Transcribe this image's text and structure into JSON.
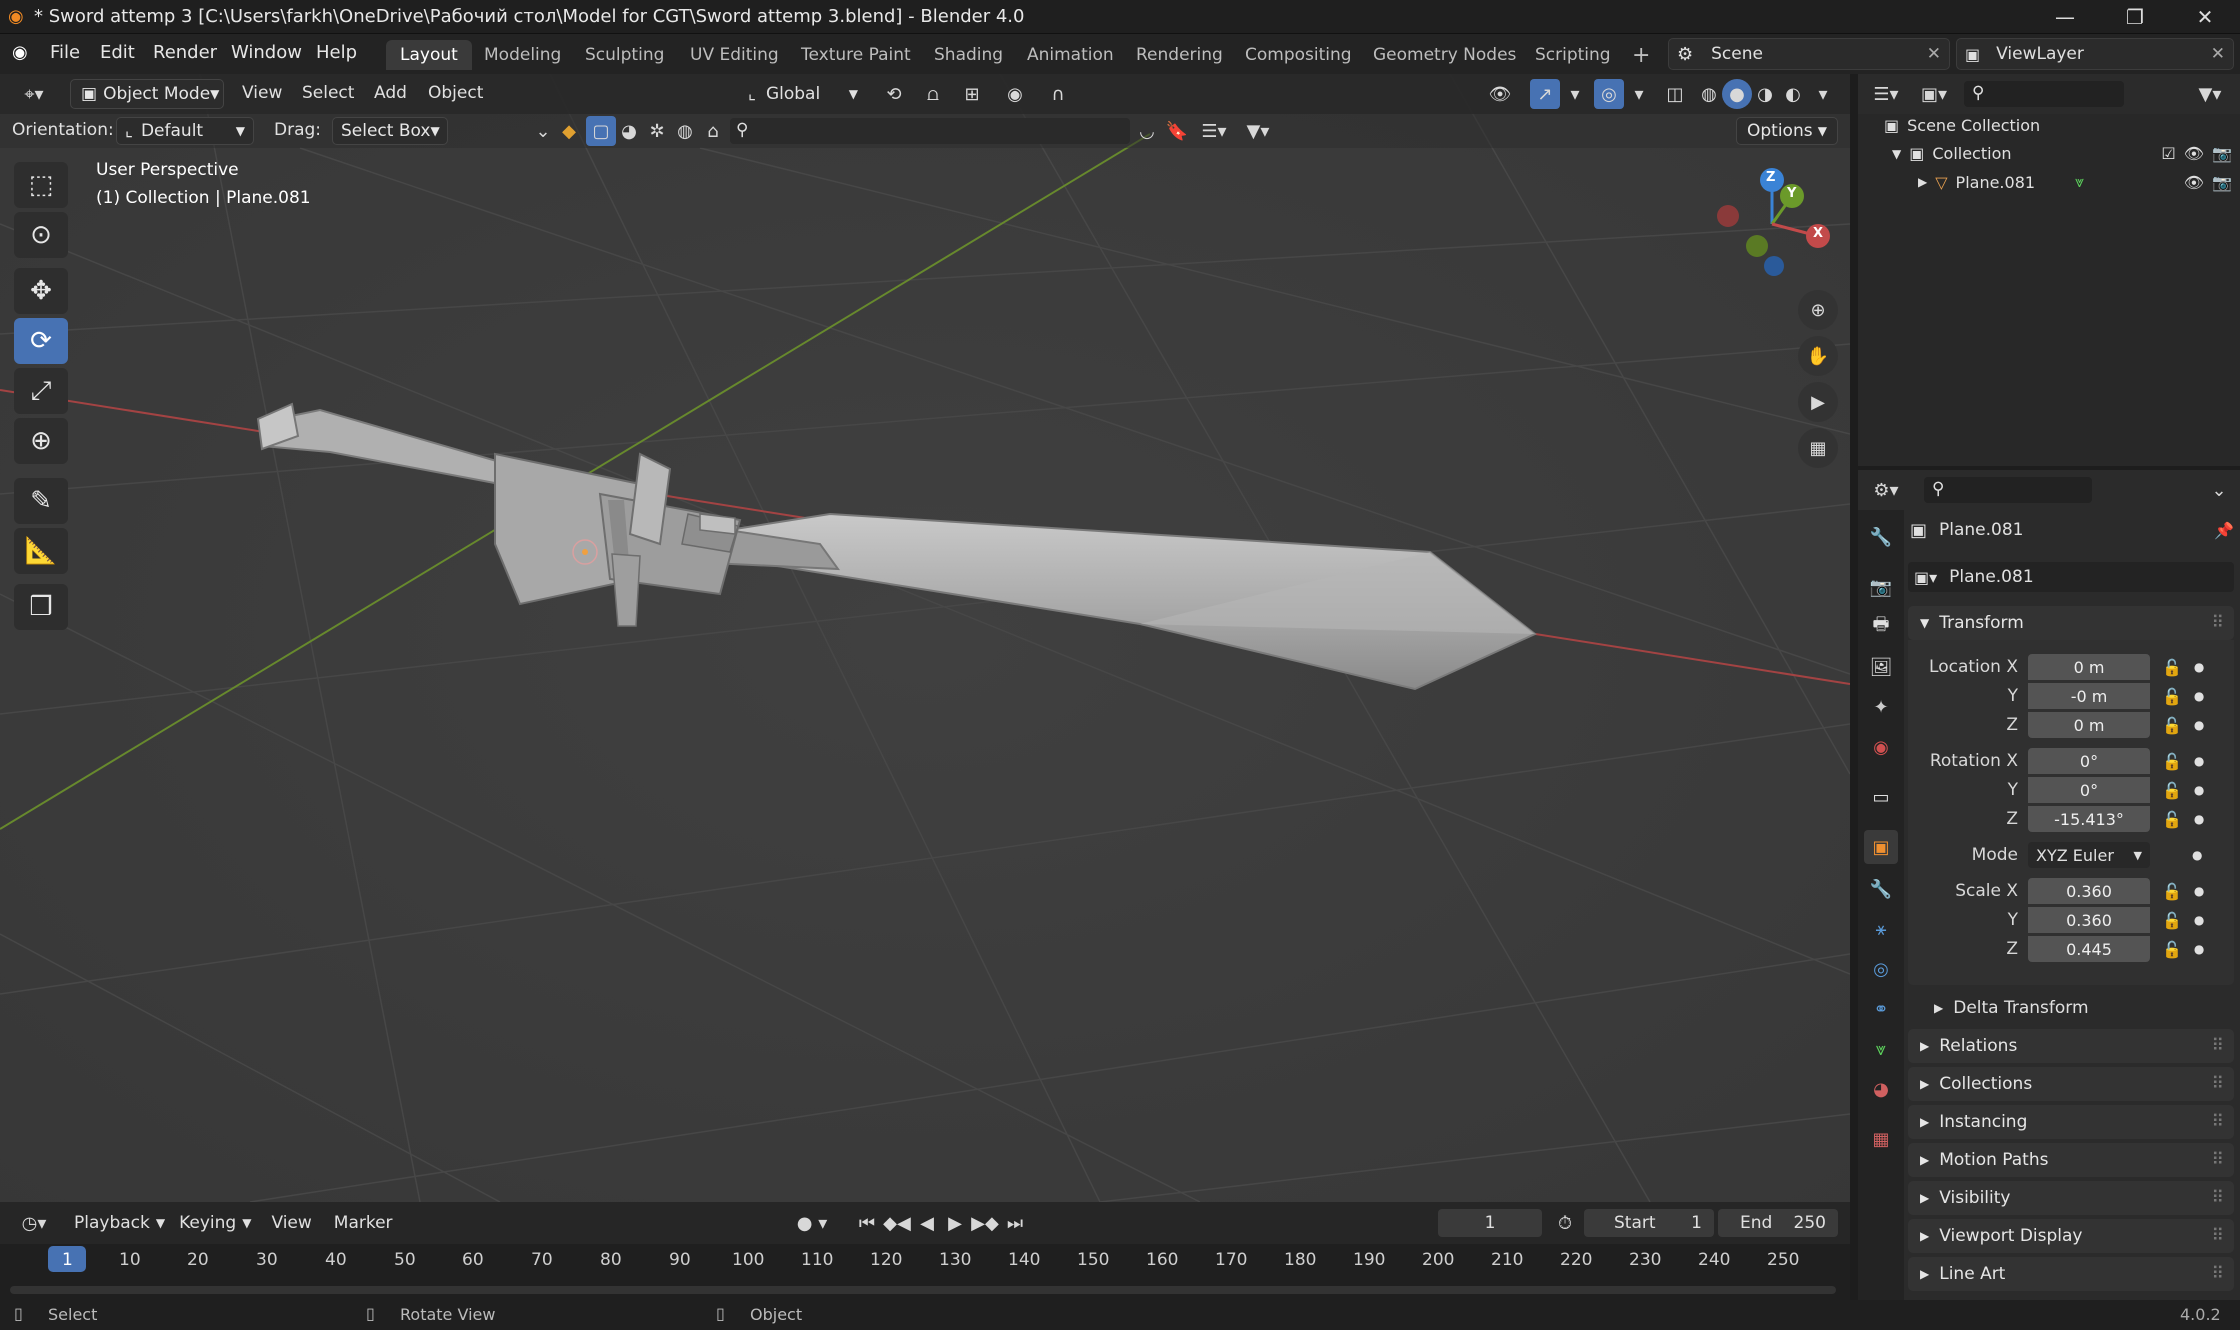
{
  "window": {
    "title": "* Sword attemp 3 [C:\\Users\\farkh\\OneDrive\\Рабочий стол\\Model for CGT\\Sword attemp 3.blend] - Blender 4.0",
    "minimize": "—",
    "maximize": "❐",
    "close": "✕"
  },
  "menu": {
    "file": "File",
    "edit": "Edit",
    "render": "Render",
    "window": "Window",
    "help": "Help"
  },
  "workspaces": [
    "Layout",
    "Modeling",
    "Sculpting",
    "UV Editing",
    "Texture Paint",
    "Shading",
    "Animation",
    "Rendering",
    "Compositing",
    "Geometry Nodes",
    "Scripting"
  ],
  "scene": {
    "name": "Scene",
    "view_layer": "ViewLayer"
  },
  "viewport_header": {
    "mode": "Object Mode",
    "view": "View",
    "select": "Select",
    "add": "Add",
    "object": "Object",
    "transform": "Global",
    "orientation_label": "Orientation:",
    "orientation": "Default",
    "drag_label": "Drag:",
    "drag": "Select Box",
    "options": "Options"
  },
  "viewport_overlay": {
    "perspective": "User Perspective",
    "collection": "(1) Collection | Plane.081"
  },
  "gizmo": {
    "x": "X",
    "y": "Y",
    "z": "Z"
  },
  "outliner": {
    "scene_collection": "Scene Collection",
    "collection": "Collection",
    "object": "Plane.081"
  },
  "properties": {
    "object_name": "Plane.081",
    "object_field": "Plane.081",
    "transform_title": "Transform",
    "location_label": "Location X",
    "loc_x": "0 m",
    "loc_y": "-0 m",
    "loc_z": "0 m",
    "rotation_label": "Rotation X",
    "rot_x": "0°",
    "rot_y": "0°",
    "rot_z": "-15.413°",
    "mode_label": "Mode",
    "mode": "XYZ Euler",
    "scale_label": "Scale X",
    "scale_x": "0.360",
    "scale_y": "0.360",
    "scale_z": "0.445",
    "y_label": "Y",
    "z_label": "Z",
    "delta": "Delta Transform",
    "panels": [
      "Relations",
      "Collections",
      "Instancing",
      "Motion Paths",
      "Visibility",
      "Viewport Display",
      "Line Art"
    ]
  },
  "timeline": {
    "playback": "Playback",
    "keying": "Keying",
    "view": "View",
    "marker": "Marker",
    "current_frame": "1",
    "start_label": "Start",
    "start": "1",
    "end_label": "End",
    "end": "250",
    "frames": [
      "1",
      "10",
      "20",
      "30",
      "40",
      "50",
      "60",
      "70",
      "80",
      "90",
      "100",
      "110",
      "120",
      "130",
      "140",
      "150",
      "160",
      "170",
      "180",
      "190",
      "200",
      "210",
      "220",
      "230",
      "240",
      "250"
    ]
  },
  "status": {
    "select": "Select",
    "rotate": "Rotate View",
    "object": "Object",
    "version": "4.0.2"
  },
  "colors": {
    "accent": "#4772b3",
    "viewport_bg": "#3d3d3d",
    "x_axis": "#c24a4a",
    "y_axis": "#6b9a2a",
    "z_axis": "#3a83d6"
  }
}
